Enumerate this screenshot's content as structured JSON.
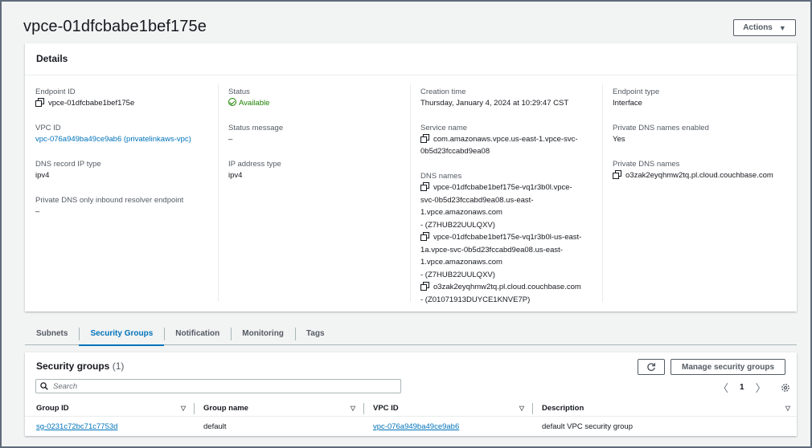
{
  "header": {
    "title": "vpce-01dfcbabe1bef175e",
    "actions_label": "Actions"
  },
  "details": {
    "title": "Details",
    "col1": {
      "endpoint_id_label": "Endpoint ID",
      "endpoint_id": "vpce-01dfcbabe1bef175e",
      "vpc_id_label": "VPC ID",
      "vpc_id": "vpc-076a949ba49ce9ab6 (privatelinkaws-vpc)",
      "dns_record_ip_type_label": "DNS record IP type",
      "dns_record_ip_type": "ipv4",
      "private_dns_inbound_label": "Private DNS only inbound resolver endpoint",
      "private_dns_inbound": "–"
    },
    "col2": {
      "status_label": "Status",
      "status": "Available",
      "status_message_label": "Status message",
      "status_message": "–",
      "ip_address_type_label": "IP address type",
      "ip_address_type": "ipv4"
    },
    "col3": {
      "creation_time_label": "Creation time",
      "creation_time": "Thursday, January 4, 2024 at 10:29:47 CST",
      "service_name_label": "Service name",
      "service_name_line1": "com.amazonaws.vpce.us-east-1.vpce-svc-",
      "service_name_line2": "0b5d23fccabd9ea08",
      "dns_names_label": "DNS names",
      "dns1_line1": "vpce-01dfcbabe1bef175e-vq1r3b0l.vpce-",
      "dns1_line2": "svc-0b5d23fccabd9ea08.us-east-",
      "dns1_line3": "1.vpce.amazonaws.com",
      "dns1_zone": "- (Z7HUB22UULQXV)",
      "dns2_line1": "vpce-01dfcbabe1bef175e-vq1r3b0l-us-east-",
      "dns2_line2": "1a.vpce-svc-0b5d23fccabd9ea08.us-east-",
      "dns2_line3": "1.vpce.amazonaws.com",
      "dns2_zone": "- (Z7HUB22UULQXV)",
      "dns3_line1": "o3zak2eyqhmw2tq.pl.cloud.couchbase.com",
      "dns3_zone": "- (Z01071913DUYCE1KNVE7P)"
    },
    "col4": {
      "endpoint_type_label": "Endpoint type",
      "endpoint_type": "Interface",
      "private_dns_enabled_label": "Private DNS names enabled",
      "private_dns_enabled": "Yes",
      "private_dns_names_label": "Private DNS names",
      "private_dns_names": "o3zak2eyqhmw2tq.pl.cloud.couchbase.com"
    }
  },
  "tabs": [
    {
      "label": "Subnets"
    },
    {
      "label": "Security Groups"
    },
    {
      "label": "Notification"
    },
    {
      "label": "Monitoring"
    },
    {
      "label": "Tags"
    }
  ],
  "security_groups": {
    "title": "Security groups",
    "count": "(1)",
    "manage_label": "Manage security groups",
    "search_placeholder": "Search",
    "page": "1",
    "columns": [
      "Group ID",
      "Group name",
      "VPC ID",
      "Description"
    ],
    "rows": [
      {
        "group_id": "sg-0231c72bc71c7753d",
        "group_name": "default",
        "vpc_id": "vpc-076a949ba49ce9ab6",
        "description": "default VPC security group"
      }
    ]
  },
  "colors": {
    "link": "#0073bb",
    "success": "#1d8102",
    "text": "#16191f",
    "muted": "#545b64"
  }
}
